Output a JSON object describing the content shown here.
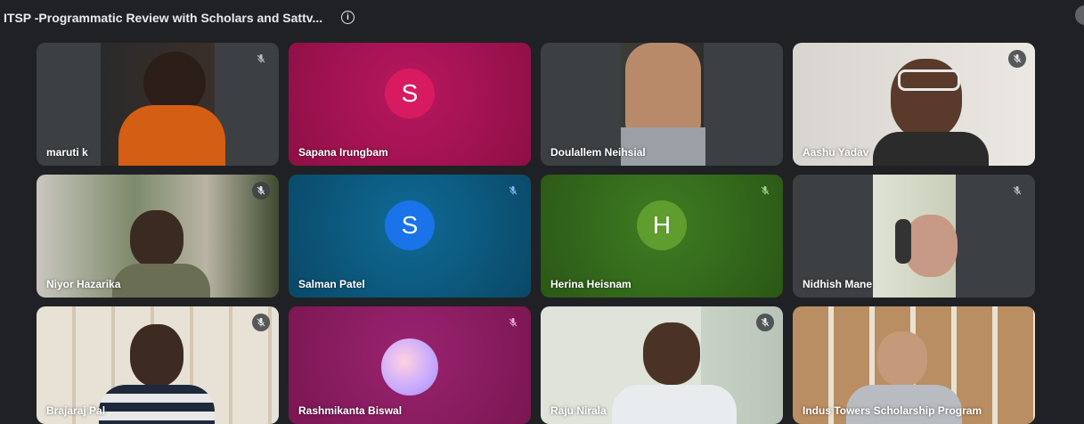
{
  "meeting": {
    "title": "ITSP -Programmatic Review with Scholars and Sattv...",
    "info_icon": "info-icon"
  },
  "participants": [
    {
      "name": "maruti k",
      "muted": true,
      "kind": "video"
    },
    {
      "name": "Sapana Irungbam",
      "muted": false,
      "kind": "avatar",
      "initial": "S",
      "avatar_color": "#c2185b",
      "bg_color": "#a0124f"
    },
    {
      "name": "Doulallem Neihsial",
      "muted": false,
      "kind": "video"
    },
    {
      "name": "Aashu Yadav",
      "muted": true,
      "kind": "video"
    },
    {
      "name": "Niyor Hazarika",
      "muted": true,
      "kind": "video"
    },
    {
      "name": "Salman Patel",
      "muted": true,
      "kind": "avatar",
      "initial": "S",
      "avatar_color": "#1a73e8",
      "bg_color": "#0b5a84"
    },
    {
      "name": "Herina Heisnam",
      "muted": true,
      "kind": "avatar",
      "initial": "H",
      "avatar_color": "#5a9e2f",
      "bg_color": "#356b1e"
    },
    {
      "name": "Nidhish Mane",
      "muted": true,
      "kind": "video"
    },
    {
      "name": "Brajaraj Pal",
      "muted": true,
      "kind": "video"
    },
    {
      "name": "Rashmikanta Biswal",
      "muted": true,
      "kind": "image-avatar",
      "bg_color": "#8a1b5f"
    },
    {
      "name": "Raju Nirala",
      "muted": true,
      "kind": "video"
    },
    {
      "name": "Indus Towers Scholarship Program",
      "muted": false,
      "kind": "video"
    }
  ],
  "icons": {
    "mic_off": "mic-off-icon"
  }
}
